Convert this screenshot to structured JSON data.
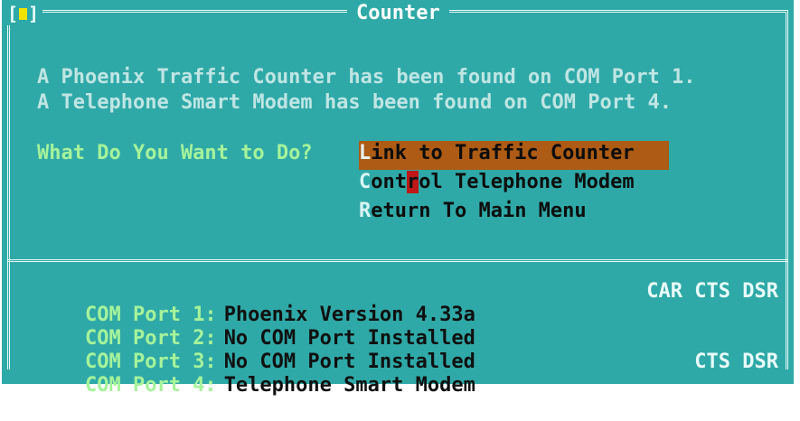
{
  "window": {
    "title": "Counter",
    "close_box": "[■]"
  },
  "messages": [
    "A Phoenix Traffic Counter has been found on COM Port 1.",
    "A Telephone Smart Modem has been found on COM Port 4."
  ],
  "prompt": "What Do You Want to Do?",
  "menu": [
    {
      "hotkey": "L",
      "rest": "ink to Traffic Counter",
      "selected": true
    },
    {
      "hotkey": "C",
      "pre": "ont",
      "cursor": "r",
      "post": "ol Telephone Modem",
      "selected": false
    },
    {
      "hotkey": "R",
      "rest": "eturn To Main Menu",
      "selected": false
    }
  ],
  "ports": [
    {
      "label": "COM Port 1:",
      "status": "Phoenix Version 4.33a",
      "signals": "CAR CTS DSR"
    },
    {
      "label": "COM Port 2:",
      "status": "No COM Port Installed",
      "signals": ""
    },
    {
      "label": "COM Port 3:",
      "status": "No COM Port Installed",
      "signals": ""
    },
    {
      "label": "COM Port 4:",
      "status": "Telephone Smart Modem",
      "signals": "CTS DSR"
    }
  ],
  "colors": {
    "background": "#2fa9a7",
    "selected_item": "#ad5b15",
    "cursor": "#c01818",
    "prompt": "#a6f39a"
  }
}
